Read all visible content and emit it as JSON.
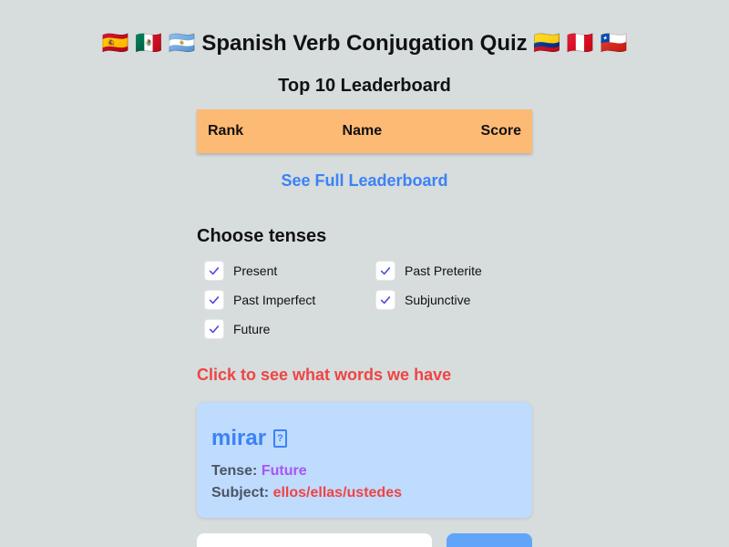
{
  "header": {
    "title": "🇪🇸 🇲🇽 🇦🇷 Spanish Verb Conjugation Quiz 🇨🇴 🇵🇪 🇨🇱"
  },
  "leaderboard": {
    "title": "Top 10 Leaderboard",
    "columns": [
      "Rank",
      "Name",
      "Score"
    ],
    "rows": [],
    "full_link": "See Full Leaderboard"
  },
  "tenses": {
    "heading": "Choose tenses",
    "options": [
      {
        "label": "Present",
        "checked": true
      },
      {
        "label": "Past Preterite",
        "checked": true
      },
      {
        "label": "Past Imperfect",
        "checked": true
      },
      {
        "label": "Subjunctive",
        "checked": true
      },
      {
        "label": "Future",
        "checked": true
      }
    ]
  },
  "words_link": "Click to see what words we have",
  "question": {
    "verb": "mirar",
    "speaker_icon": "speaker-icon",
    "tense_label": "Tense:",
    "tense_value": "Future",
    "subject_label": "Subject:",
    "subject_value": "ellos/ellas/ustedes"
  },
  "answer": {
    "value": "",
    "placeholder": "",
    "submit_label": ""
  },
  "colors": {
    "background": "#d7dcdc",
    "leaderboard_header": "#fdba74",
    "link_blue": "#3b82f6",
    "link_red": "#ef4444",
    "card": "#bfdbfe",
    "tense_value": "#a855f7",
    "check": "#4f46e5"
  }
}
